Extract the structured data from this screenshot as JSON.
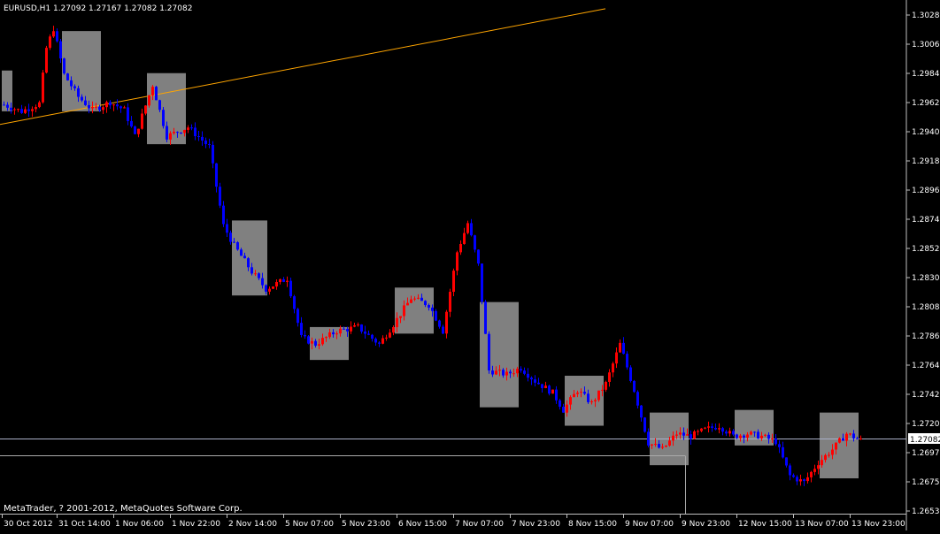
{
  "window": {
    "symbol_header": "EURUSD,H1  1.27092 1.27167 1.27082 1.27082",
    "copyright": "MetaTrader, ? 2001-2012, MetaQuotes Software Corp."
  },
  "colors": {
    "background": "#000000",
    "bull": "#ff0000",
    "bear": "#0000ff",
    "box": "#808080",
    "trendline": "#ffa500",
    "axis_text": "#ffffff",
    "axis_line": "#c0c0c0"
  },
  "chart_data": {
    "type": "candlestick",
    "price_labels": [
      "1.30285",
      "1.30065",
      "1.29845",
      "1.29625",
      "1.29405",
      "1.29185",
      "1.28960",
      "1.28740",
      "1.28520",
      "1.28300",
      "1.28080",
      "1.27860",
      "1.27640",
      "1.27420",
      "1.27200",
      "1.26975",
      "1.26755",
      "1.26535"
    ],
    "current_price_label": "1.27082",
    "current_price": 1.27082,
    "secondary_level": 1.26955,
    "time_labels": [
      "30 Oct 2012",
      "31 Oct 14:00",
      "1 Nov 06:00",
      "1 Nov 22:00",
      "2 Nov 14:00",
      "5 Nov 07:00",
      "5 Nov 23:00",
      "6 Nov 15:00",
      "7 Nov 07:00",
      "7 Nov 23:00",
      "8 Nov 15:00",
      "9 Nov 07:00",
      "9 Nov 23:00",
      "12 Nov 15:00",
      "13 Nov 07:00",
      "13 Nov 23:00"
    ],
    "ylim": [
      1.26535,
      1.30285
    ],
    "trendline": {
      "start": {
        "bar": 0,
        "price": 1.2947
      },
      "end": {
        "bar": 170,
        "price": 1.3035
      }
    },
    "vertical_marker_bar": 192,
    "anchors": [
      {
        "bar": 0,
        "price": 1.2962
      },
      {
        "bar": 5,
        "price": 1.2957
      },
      {
        "bar": 10,
        "price": 1.2963
      },
      {
        "bar": 12,
        "price": 1.3005
      },
      {
        "bar": 14,
        "price": 1.302
      },
      {
        "bar": 17,
        "price": 1.2985
      },
      {
        "bar": 21,
        "price": 1.2968
      },
      {
        "bar": 25,
        "price": 1.2958
      },
      {
        "bar": 30,
        "price": 1.2964
      },
      {
        "bar": 34,
        "price": 1.2958
      },
      {
        "bar": 37,
        "price": 1.2938
      },
      {
        "bar": 42,
        "price": 1.2977
      },
      {
        "bar": 46,
        "price": 1.2938
      },
      {
        "bar": 52,
        "price": 1.2945
      },
      {
        "bar": 58,
        "price": 1.293
      },
      {
        "bar": 62,
        "price": 1.287
      },
      {
        "bar": 65,
        "price": 1.2855
      },
      {
        "bar": 70,
        "price": 1.2835
      },
      {
        "bar": 74,
        "price": 1.2822
      },
      {
        "bar": 80,
        "price": 1.283
      },
      {
        "bar": 84,
        "price": 1.2785
      },
      {
        "bar": 88,
        "price": 1.278
      },
      {
        "bar": 94,
        "price": 1.279
      },
      {
        "bar": 100,
        "price": 1.2793
      },
      {
        "bar": 106,
        "price": 1.278
      },
      {
        "bar": 110,
        "price": 1.2795
      },
      {
        "bar": 115,
        "price": 1.2815
      },
      {
        "bar": 120,
        "price": 1.281
      },
      {
        "bar": 124,
        "price": 1.279
      },
      {
        "bar": 128,
        "price": 1.285
      },
      {
        "bar": 131,
        "price": 1.2872
      },
      {
        "bar": 134,
        "price": 1.284
      },
      {
        "bar": 137,
        "price": 1.276
      },
      {
        "bar": 142,
        "price": 1.2757
      },
      {
        "bar": 146,
        "price": 1.2762
      },
      {
        "bar": 150,
        "price": 1.2752
      },
      {
        "bar": 155,
        "price": 1.2743
      },
      {
        "bar": 158,
        "price": 1.273
      },
      {
        "bar": 162,
        "price": 1.2745
      },
      {
        "bar": 166,
        "price": 1.2735
      },
      {
        "bar": 170,
        "price": 1.275
      },
      {
        "bar": 174,
        "price": 1.278
      },
      {
        "bar": 178,
        "price": 1.2745
      },
      {
        "bar": 182,
        "price": 1.2705
      },
      {
        "bar": 186,
        "price": 1.27
      },
      {
        "bar": 190,
        "price": 1.2712
      },
      {
        "bar": 194,
        "price": 1.271
      },
      {
        "bar": 198,
        "price": 1.2715
      },
      {
        "bar": 202,
        "price": 1.2718
      },
      {
        "bar": 206,
        "price": 1.271
      },
      {
        "bar": 210,
        "price": 1.2712
      },
      {
        "bar": 214,
        "price": 1.271
      },
      {
        "bar": 218,
        "price": 1.2706
      },
      {
        "bar": 222,
        "price": 1.268
      },
      {
        "bar": 226,
        "price": 1.2675
      },
      {
        "bar": 230,
        "price": 1.269
      },
      {
        "bar": 234,
        "price": 1.27
      },
      {
        "bar": 238,
        "price": 1.2712
      },
      {
        "bar": 242,
        "price": 1.2707
      }
    ],
    "boxes": [
      {
        "bar_from": 0,
        "bar_to": 2,
        "high": 1.2988,
        "low": 1.2957
      },
      {
        "bar_from": 17,
        "bar_to": 27,
        "high": 1.3018,
        "low": 1.2957
      },
      {
        "bar_from": 41,
        "bar_to": 51,
        "high": 1.2986,
        "low": 1.2932
      },
      {
        "bar_from": 65,
        "bar_to": 74,
        "high": 1.2874,
        "low": 1.2817
      },
      {
        "bar_from": 87,
        "bar_to": 97,
        "high": 1.2793,
        "low": 1.2768
      },
      {
        "bar_from": 111,
        "bar_to": 121,
        "high": 1.2823,
        "low": 1.2788
      },
      {
        "bar_from": 135,
        "bar_to": 145,
        "high": 1.2812,
        "low": 1.2732
      },
      {
        "bar_from": 159,
        "bar_to": 169,
        "high": 1.2756,
        "low": 1.2718
      },
      {
        "bar_from": 183,
        "bar_to": 193,
        "high": 1.2728,
        "low": 1.2688
      },
      {
        "bar_from": 207,
        "bar_to": 217,
        "high": 1.273,
        "low": 1.2703
      },
      {
        "bar_from": 231,
        "bar_to": 241,
        "high": 1.2728,
        "low": 1.2678
      }
    ]
  }
}
